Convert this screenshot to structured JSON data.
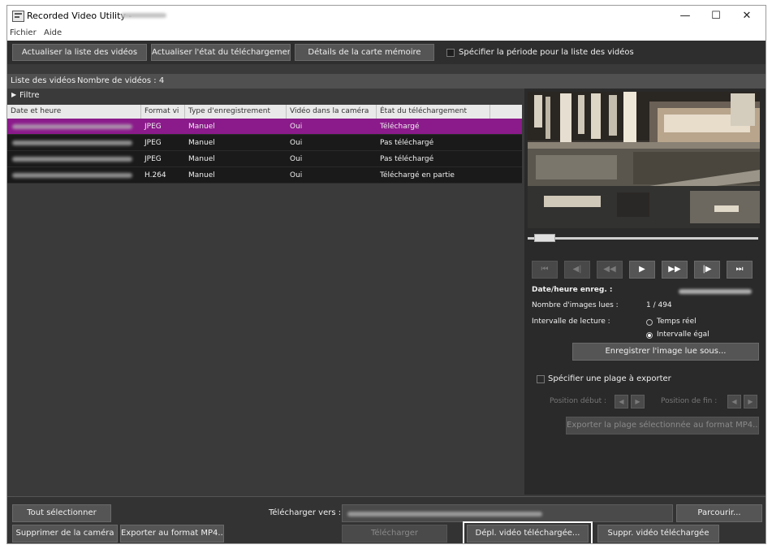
{
  "window": {
    "title": "Recorded Video Utility -",
    "minimize_glyph": "—",
    "maximize_glyph": "☐",
    "close_glyph": "✕"
  },
  "menu": {
    "file": "Fichier",
    "help": "Aide"
  },
  "toolbar": {
    "refresh_list": "Actualiser la liste des vidéos",
    "refresh_download_status": "Actualiser l'état du téléchargement",
    "memory_card_details": "Détails de la carte mémoire",
    "specify_period": "Spécifier la période pour la liste des vidéos"
  },
  "list": {
    "header": "Liste des vidéos",
    "count_label": "Nombre de vidéos : 4",
    "filter_label": "Filtre",
    "columns": [
      "Date et heure",
      "Format vi",
      "Type d'enregistrement",
      "Vidéo dans la caméra",
      "État du téléchargement"
    ],
    "rows": [
      {
        "format": "JPEG",
        "type": "Manuel",
        "in_camera": "Oui",
        "status": "Téléchargé"
      },
      {
        "format": "JPEG",
        "type": "Manuel",
        "in_camera": "Oui",
        "status": "Pas téléchargé"
      },
      {
        "format": "JPEG",
        "type": "Manuel",
        "in_camera": "Oui",
        "status": "Pas téléchargé"
      },
      {
        "format": "H.264",
        "type": "Manuel",
        "in_camera": "Oui",
        "status": "Téléchargé en partie"
      }
    ],
    "selected_row": 0,
    "selected_color": "#8b1a8b"
  },
  "player": {
    "scrub_position": 0.03,
    "buttons": [
      {
        "glyph": "⏮",
        "icon": "skip-to-start-icon",
        "enabled": false
      },
      {
        "glyph": "◀|",
        "icon": "frame-back-icon",
        "enabled": false
      },
      {
        "glyph": "◀◀",
        "icon": "rewind-icon",
        "enabled": false
      },
      {
        "glyph": "▶",
        "icon": "play-icon",
        "enabled": true
      },
      {
        "glyph": "▶▶",
        "icon": "fast-forward-icon",
        "enabled": true
      },
      {
        "glyph": "|▶",
        "icon": "frame-forward-icon",
        "enabled": true
      },
      {
        "glyph": "⏭",
        "icon": "skip-to-end-icon",
        "enabled": true
      }
    ],
    "rec_datetime_label": "Date/heure enreg. :",
    "frames_read_label": "Nombre d'images lues :",
    "frames_read_value": "1 / 494",
    "interval_label": "Intervalle de lecture :",
    "realtime_option": "Temps réel",
    "equal_interval_option": "Intervalle égal",
    "save_image_button": "Enregistrer l'image lue sous...",
    "specify_range_label": "Spécifier une plage à exporter",
    "start_position_label": "Position début :",
    "end_position_label": "Position de fin :",
    "export_range_button": "Exporter la plage sélectionnée au format MP4..."
  },
  "bottom": {
    "select_all": "Tout sélectionner",
    "download_to_label": "Télécharger vers :",
    "browse": "Parcourir...",
    "delete_from_camera": "Supprimer de la caméra",
    "export_mp4": "Exporter au format MP4...",
    "download": "Télécharger",
    "move_downloaded": "Dépl. vidéo téléchargée...",
    "delete_downloaded": "Suppr. vidéo téléchargée"
  }
}
